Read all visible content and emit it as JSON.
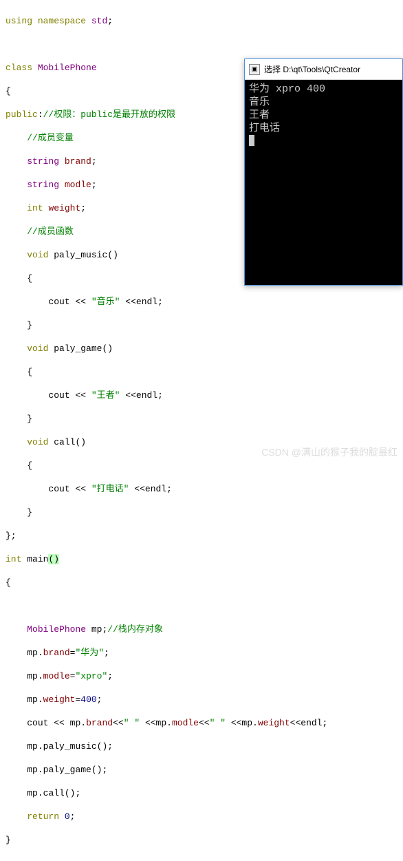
{
  "code": {
    "l1_kw": "using",
    "l1_ns": "namespace",
    "l1_std": "std",
    "l3_kw": "class",
    "l3_name": "MobilePhone",
    "l5_public": "public",
    "l5_comment": "//权限：public是最开放的权限",
    "l6_comment": "//成员变量",
    "l7_type": "string",
    "l7_var": "brand",
    "l8_type": "string",
    "l8_var": "modle",
    "l9_type": "int",
    "l9_var": "weight",
    "l10_comment": "//成员函数",
    "l11_void": "void",
    "l11_fn": "paly_music",
    "l13_cout": "cout",
    "l13_str": "\"音乐\"",
    "l13_endl": "endl",
    "l15_void": "void",
    "l15_fn": "paly_game",
    "l17_cout": "cout",
    "l17_str": "\"王者\"",
    "l17_endl": "endl",
    "l19_void": "void",
    "l19_fn": "call",
    "l21_cout": "cout",
    "l21_str": "\"打电话\"",
    "l21_endl": "endl",
    "l24_int": "int",
    "l24_main": "main",
    "l26_type": "MobilePhone",
    "l26_var": "mp",
    "l26_comment": "//栈内存对象",
    "l27_obj": "mp",
    "l27_mem": "brand",
    "l27_str": "\"华为\"",
    "l28_obj": "mp",
    "l28_mem": "modle",
    "l28_str": "\"xpro\"",
    "l29_obj": "mp",
    "l29_mem": "weight",
    "l29_num": "400",
    "l30_cout": "cout",
    "l30_o1": "mp",
    "l30_m1": "brand",
    "l30_s1": "\" \"",
    "l30_o2": "mp",
    "l30_m2": "modle",
    "l30_s2": "\" \"",
    "l30_o3": "mp",
    "l30_m3": "weight",
    "l30_endl": "endl",
    "l31_obj": "mp",
    "l31_fn": "paly_music",
    "l32_obj": "mp",
    "l32_fn": "paly_game",
    "l33_obj": "mp",
    "l33_fn": "call",
    "l34_ret": "return",
    "l34_num": "0"
  },
  "console": {
    "title": "选择 D:\\qt\\Tools\\QtCreator",
    "line1": "华为 xpro 400",
    "line2": "音乐",
    "line3": "王者",
    "line4": "打电话"
  },
  "watermark": "CSDN @满山的猴子我的腚最红"
}
